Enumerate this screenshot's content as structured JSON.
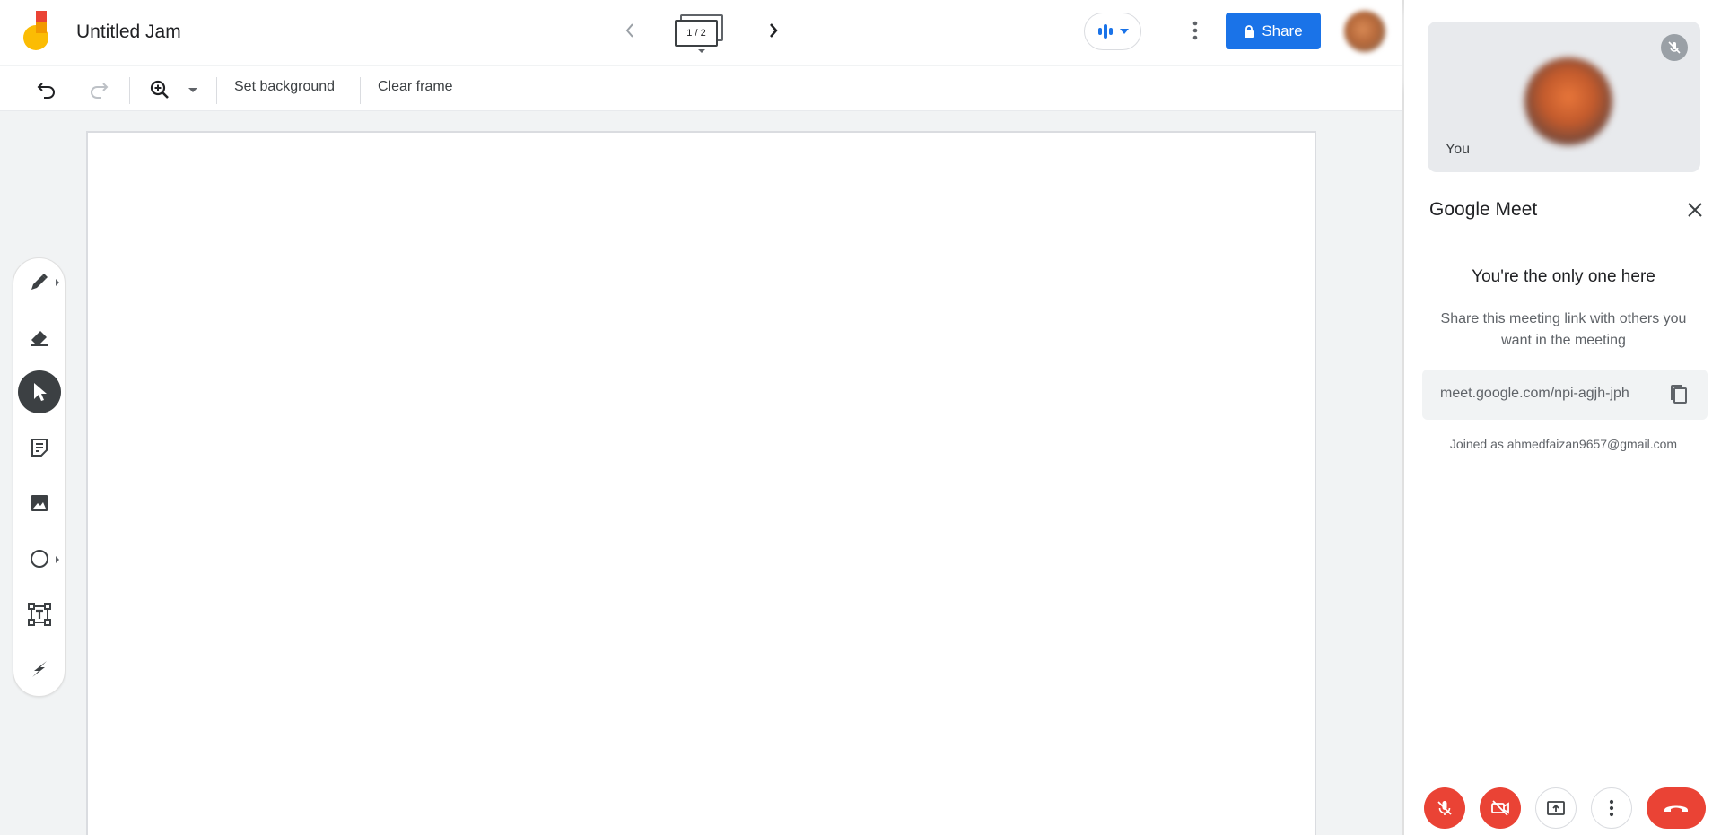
{
  "app": {
    "title": "Untitled Jam",
    "frame_indicator": "1 / 2",
    "share_label": "Share"
  },
  "toolbar": {
    "set_background": "Set background",
    "clear_frame": "Clear frame"
  },
  "tools": [
    {
      "name": "pen-tool",
      "icon": "pen-icon"
    },
    {
      "name": "eraser-tool",
      "icon": "eraser-icon"
    },
    {
      "name": "select-tool",
      "icon": "cursor-icon",
      "active": true
    },
    {
      "name": "sticky-note-tool",
      "icon": "sticky-note-icon"
    },
    {
      "name": "image-tool",
      "icon": "image-icon"
    },
    {
      "name": "shape-tool",
      "icon": "circle-icon"
    },
    {
      "name": "text-box-tool",
      "icon": "text-box-icon"
    },
    {
      "name": "laser-tool",
      "icon": "laser-icon"
    }
  ],
  "meet": {
    "self_label": "You",
    "panel_title": "Google Meet",
    "only_one_title": "You're the only one here",
    "share_info": "Share this meeting link with others you want in the meeting",
    "meeting_link": "meet.google.com/npi-agjh-jph",
    "joined_as": "Joined as ahmedfaizan9657@gmail.com"
  },
  "colors": {
    "accent_blue": "#1a73e8",
    "danger_red": "#ea4335",
    "icon_grey": "#5f6368"
  }
}
